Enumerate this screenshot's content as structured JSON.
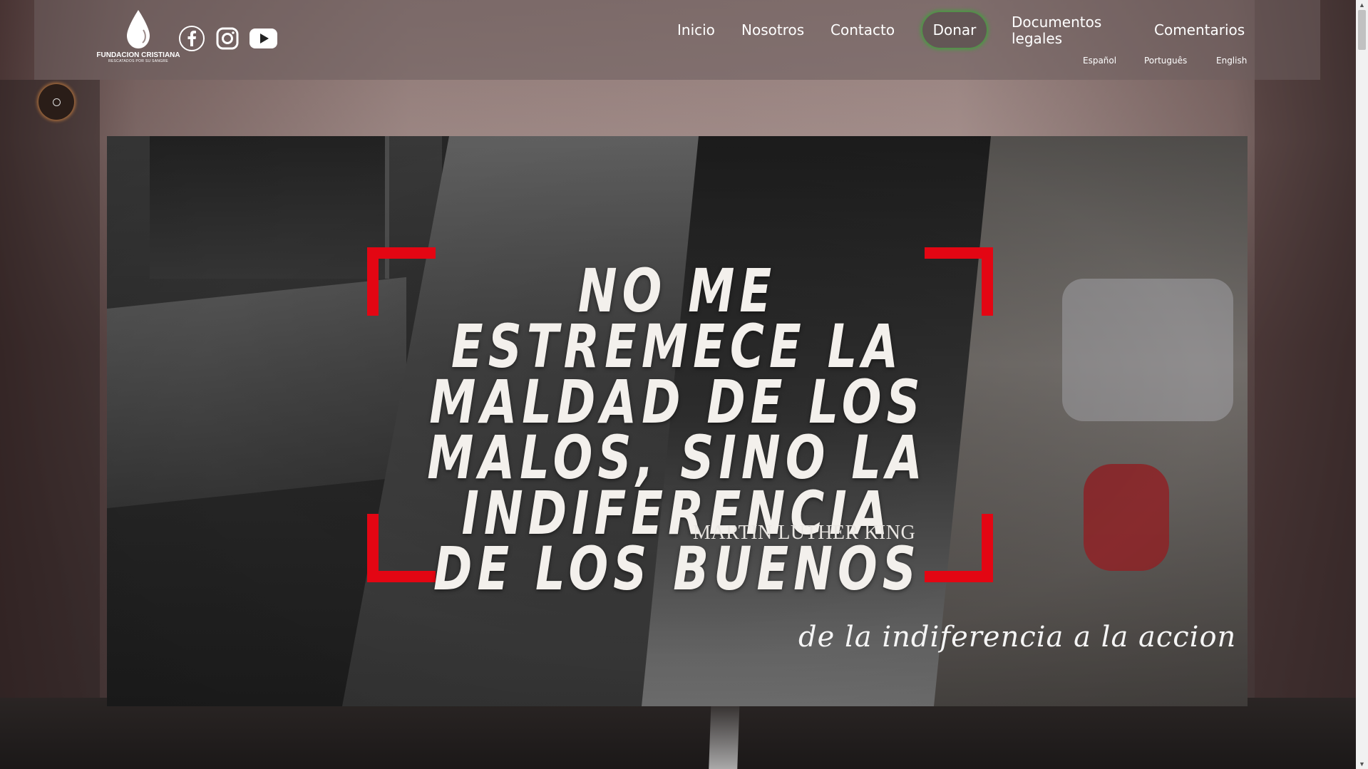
{
  "header": {
    "logo": {
      "icon": "drop-icon",
      "name": "FUNDACION CRISTIANA",
      "subtitle": "RESCATADOS POR SU SANGRE"
    },
    "social": [
      {
        "name": "facebook-icon"
      },
      {
        "name": "instagram-icon"
      },
      {
        "name": "youtube-icon"
      }
    ],
    "nav": {
      "inicio": "Inicio",
      "nosotros": "Nosotros",
      "contacto": "Contacto",
      "donar": "Donar",
      "documentos": "Documentos legales",
      "comentarios": "Comentarios"
    },
    "languages": {
      "es": "Español",
      "pt": "Português",
      "en": "English"
    }
  },
  "banner": {
    "quote": "NO ME ESTREMECE LA MALDAD DE LOS MALOS, SINO LA INDIFERENCIA DE LOS BUENOS",
    "author": "MARTIN LUTHER KING",
    "tagline": "de la indiferencia a la accion"
  },
  "colors": {
    "accent_red": "#e30613",
    "donar_glow": "#28b428",
    "side_button_glow": "#be783c"
  }
}
